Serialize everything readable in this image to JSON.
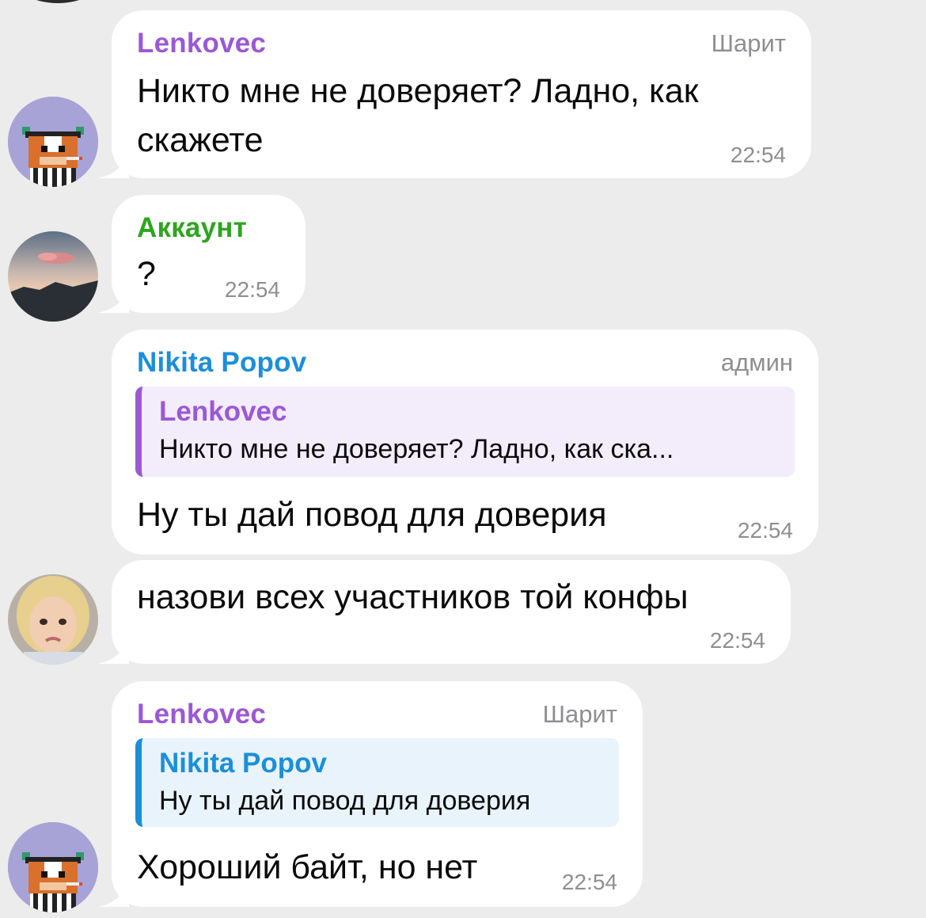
{
  "colors": {
    "background": "#ececec",
    "bubble": "#ffffff",
    "lenkovec": "#9b58d6",
    "akkaunt": "#2ea51f",
    "nikita": "#1b8fd8",
    "meta": "#8e8e93"
  },
  "messages": [
    {
      "sender": "Lenkovec",
      "role": "Шарит",
      "line1": "Никто мне не доверяет? Ладно, как",
      "line2": "скажете",
      "time": "22:54",
      "avatar_icon": "pixel-cow-avatar"
    },
    {
      "sender": "Аккаунт",
      "text": "?",
      "time": "22:54",
      "avatar_icon": "sunset-mountain-avatar"
    },
    {
      "sender": "Nikita Popov",
      "role": "админ",
      "reply": {
        "name": "Lenkovec",
        "text": "Никто мне не доверяет? Ладно, как ска..."
      },
      "text": "Ну ты дай повод для доверия",
      "time": "22:54"
    },
    {
      "text": "назови всех участников той конфы",
      "time": "22:54",
      "avatar_icon": "girl-photo-avatar"
    },
    {
      "sender": "Lenkovec",
      "role": "Шарит",
      "reply": {
        "name": "Nikita Popov",
        "text": "Ну ты дай повод для доверия"
      },
      "text": "Хороший байт, но нет",
      "time": "22:54",
      "avatar_icon": "pixel-cow-avatar"
    }
  ]
}
